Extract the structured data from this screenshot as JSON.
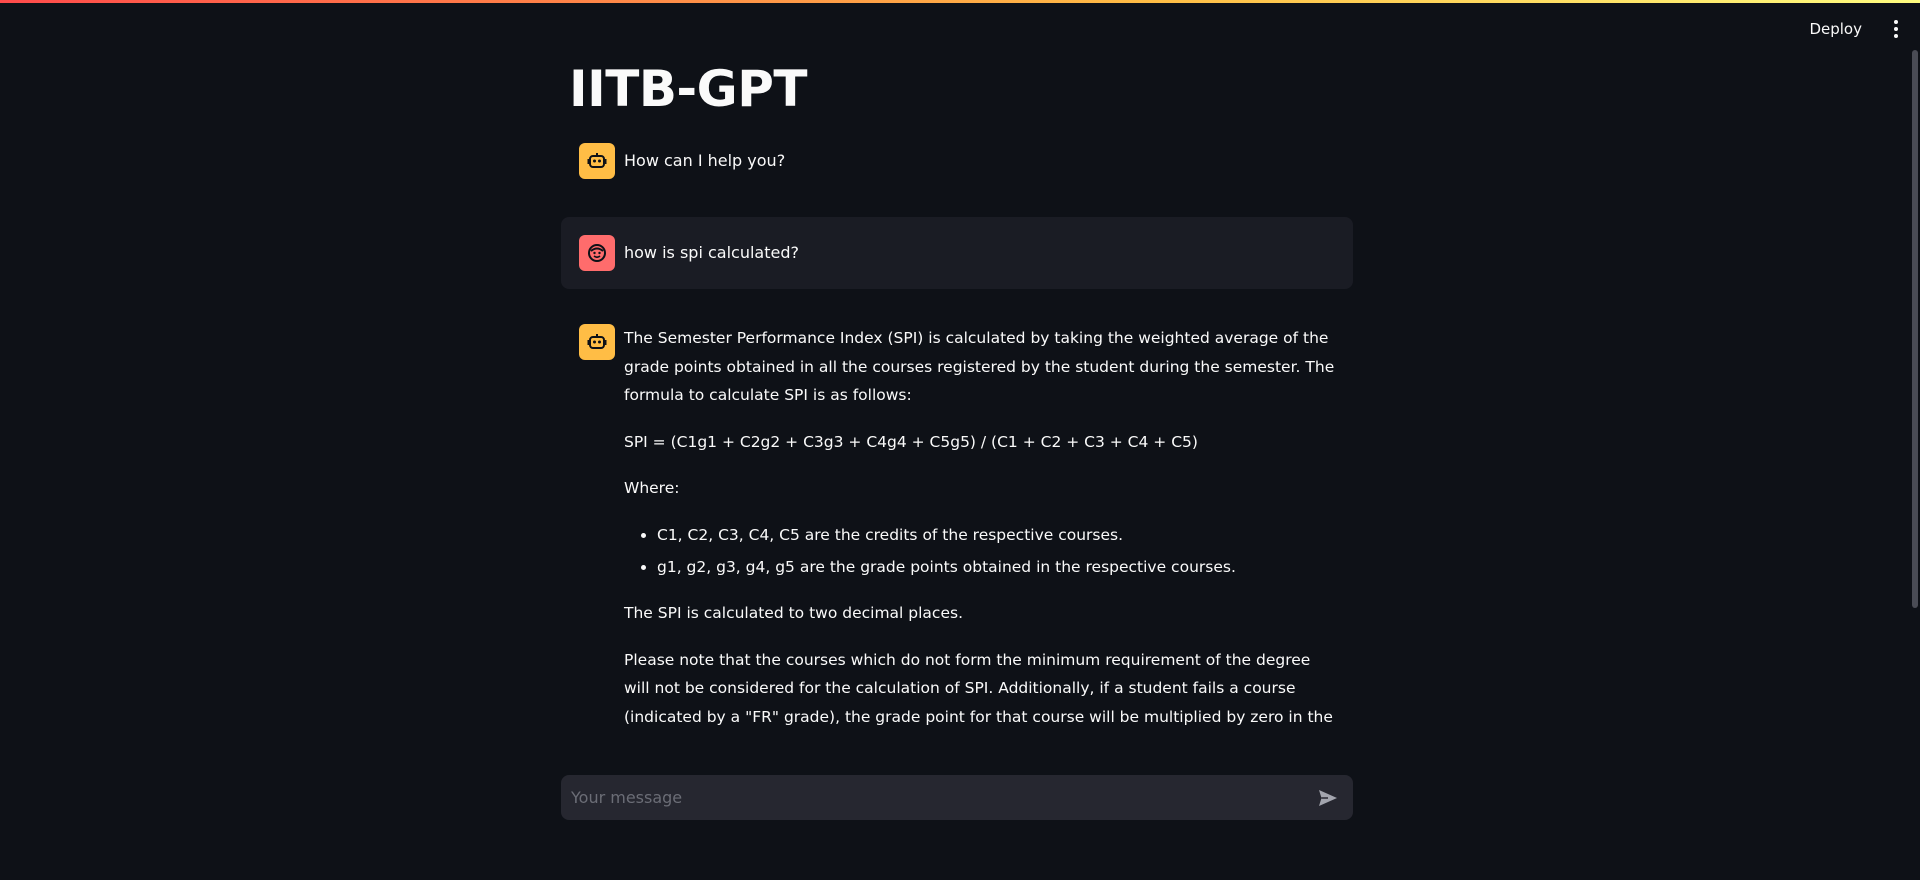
{
  "header": {
    "deploy_label": "Deploy",
    "menu_icon": "more-vertical-icon"
  },
  "app": {
    "title": "IITB-GPT"
  },
  "colors": {
    "background": "#0e1117",
    "bot_avatar": "#ffbd45",
    "user_avatar": "#ff6c6c",
    "user_bubble": "#1a1c24",
    "input_bg": "#262730"
  },
  "messages": [
    {
      "role": "assistant",
      "avatar_icon": "robot-icon",
      "text": "How can I help you?"
    },
    {
      "role": "user",
      "avatar_icon": "smiley-face-icon",
      "text": "how is spi calculated?"
    },
    {
      "role": "assistant",
      "avatar_icon": "robot-icon",
      "paragraphs": [
        "The Semester Performance Index (SPI) is calculated by taking the weighted average of the grade points obtained in all the courses registered by the student during the semester. The formula to calculate SPI is as follows:",
        "SPI = (C1g1 + C2g2 + C3g3 + C4g4 + C5g5) / (C1 + C2 + C3 + C4 + C5)",
        "Where:"
      ],
      "bullets": [
        "C1, C2, C3, C4, C5 are the credits of the respective courses.",
        "g1, g2, g3, g4, g5 are the grade points obtained in the respective courses."
      ],
      "closing": [
        "The SPI is calculated to two decimal places.",
        "Please note that the courses which do not form the minimum requirement of the degree will not be considered for the calculation of SPI. Additionally, if a student fails a course (indicated by a \"FR\" grade), the grade point for that course will be multiplied by zero in the"
      ]
    }
  ],
  "chat_input": {
    "placeholder": "Your message",
    "value": "",
    "send_icon": "send-icon"
  }
}
